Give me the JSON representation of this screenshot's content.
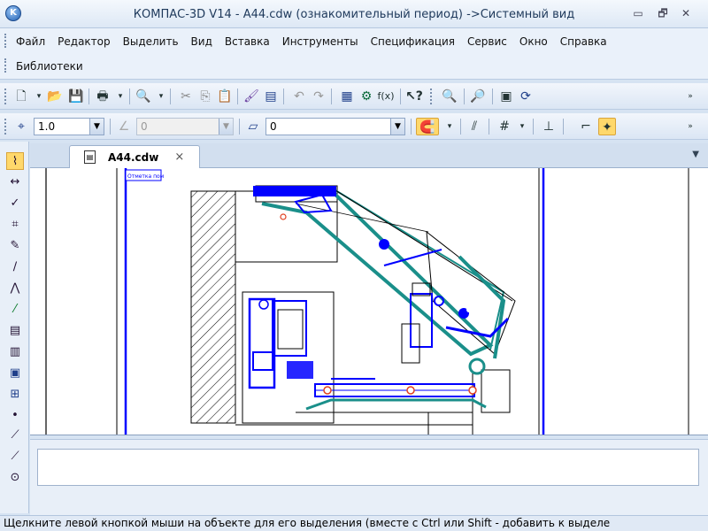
{
  "window": {
    "title": "КОМПАС-3D V14 - A44.cdw (ознакомительный период) ->Системный вид",
    "logo_letter": "K",
    "minimize": "▭",
    "restore": "🗗",
    "close": "✕"
  },
  "menu": {
    "items": [
      "Файл",
      "Редактор",
      "Выделить",
      "Вид",
      "Вставка",
      "Инструменты",
      "Спецификация",
      "Сервис",
      "Окно",
      "Справка"
    ],
    "second_row": [
      "Библиотеки"
    ]
  },
  "toolbar2": {
    "step_value": "1.0",
    "angle_value": "0",
    "layer_value": "0"
  },
  "document": {
    "tab_label": "A44.cdw",
    "tab_close": "×",
    "dropdown": "▼"
  },
  "drawing": {
    "title_block_text": "Отметка пом"
  },
  "status": {
    "text": "Щелкните левой кнопкой мыши на объекте для его выделения (вместе с Ctrl или Shift - добавить к выделе"
  },
  "colors": {
    "accent_blue": "#0000ff",
    "teal": "#1a8f8a",
    "window_bg": "#d6e3f2"
  }
}
